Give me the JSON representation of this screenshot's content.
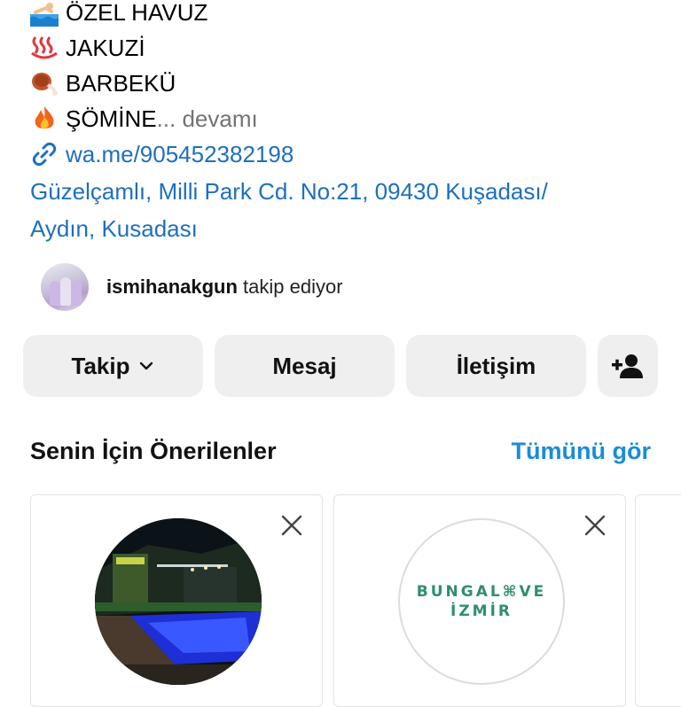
{
  "bio": {
    "lines": [
      {
        "icon": "swimmer-icon",
        "text": "ÖZEL HAVUZ"
      },
      {
        "icon": "hot-springs-icon",
        "text": "JAKUZİ"
      },
      {
        "icon": "meat-on-bone-icon",
        "text": "BARBEKÜ"
      },
      {
        "icon": "fire-icon",
        "text": "ŞÖMİNE",
        "more": "... devamı"
      }
    ],
    "link": {
      "icon": "link-icon",
      "text": "wa.me/905452382198"
    },
    "address_line1": "Güzelçamlı, Milli Park Cd. No:21, 09430 Kuşadası/",
    "address_line2": "Aydın, Kusadası"
  },
  "followed_by": {
    "username": "ismihanakgun",
    "suffix": "takip ediyor"
  },
  "actions": {
    "follow_label": "Takip",
    "message_label": "Mesaj",
    "contact_label": "İletişim",
    "add_person_icon": "person-add-icon"
  },
  "suggestions": {
    "title": "Senin İçin Önerilenler",
    "see_all": "Tümünü gör",
    "cards": [
      {
        "image": "pool-night-photo",
        "close_icon": "close-icon"
      },
      {
        "logo_line1": "BUNGAL⌘VE",
        "logo_line2": "İZMİR",
        "close_icon": "close-icon"
      }
    ]
  },
  "colors": {
    "link": "#1e6fbf",
    "accent": "#1a8cd8",
    "button_bg": "#efefef",
    "muted": "#737373"
  }
}
